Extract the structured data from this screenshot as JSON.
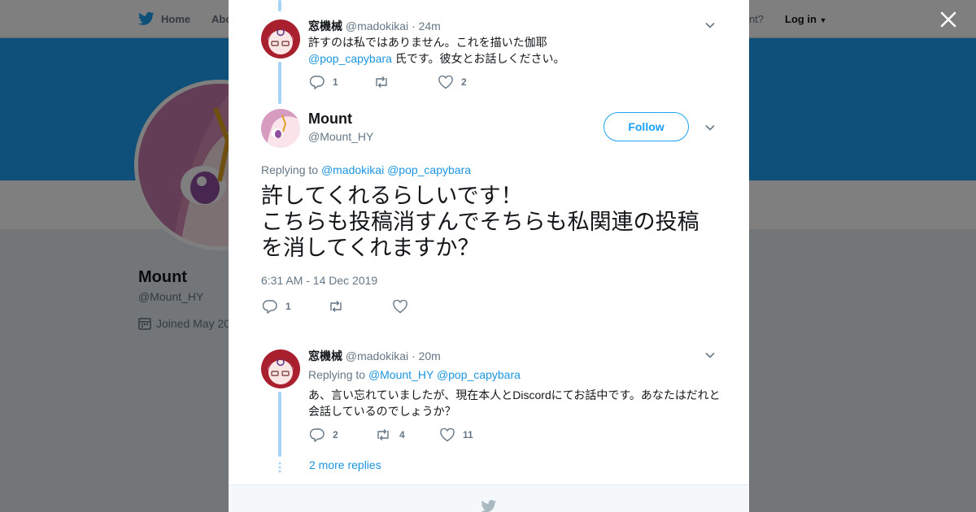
{
  "background": {
    "nav": {
      "home": "Home",
      "about": "Abo",
      "account_prompt": "count?",
      "login": "Log in"
    },
    "profile": {
      "name": "Mount",
      "handle": "@Mount_HY",
      "joined": "Joined May 20"
    }
  },
  "tweets": {
    "first": {
      "display_name": "窓機械",
      "handle": "@madokikai",
      "sep": "·",
      "time": "24m",
      "text_line1": "許すのは私ではありません。これを描いた伽耶",
      "text_mention": "@pop_capybara",
      "text_line2_rest": " 氏です。彼女とお話しください。",
      "reply_count": "1",
      "retweet_count": "",
      "like_count": "2"
    },
    "main": {
      "display_name": "Mount",
      "handle": "@Mount_HY",
      "follow_label": "Follow",
      "replying_label": "Replying to",
      "replying_to_1": "@madokikai",
      "replying_to_2": "@pop_capybara",
      "text_line1": "許してくれるらしいです！",
      "text_line2": "こちらも投稿消すんでそちらも私関連の投稿",
      "text_line3": "を消してくれますか？",
      "timestamp": "6:31 AM - 14 Dec 2019",
      "reply_count": "1"
    },
    "third": {
      "display_name": "窓機械",
      "handle": "@madokikai",
      "sep": "·",
      "time": "20m",
      "replying_label": "Replying to",
      "replying_to_1": "@Mount_HY",
      "replying_to_2": "@pop_capybara",
      "text": "あ、言い忘れていましたが、現在本人とDiscordにてお話中です。あなたはだれと会話しているのでしょうか？",
      "reply_count": "2",
      "retweet_count": "4",
      "like_count": "11",
      "more_replies": "2 more replies"
    }
  },
  "colors": {
    "accent": "#1da1f2",
    "link": "#1b95e0",
    "thread": "#a5d4f5",
    "muted": "#657786"
  }
}
